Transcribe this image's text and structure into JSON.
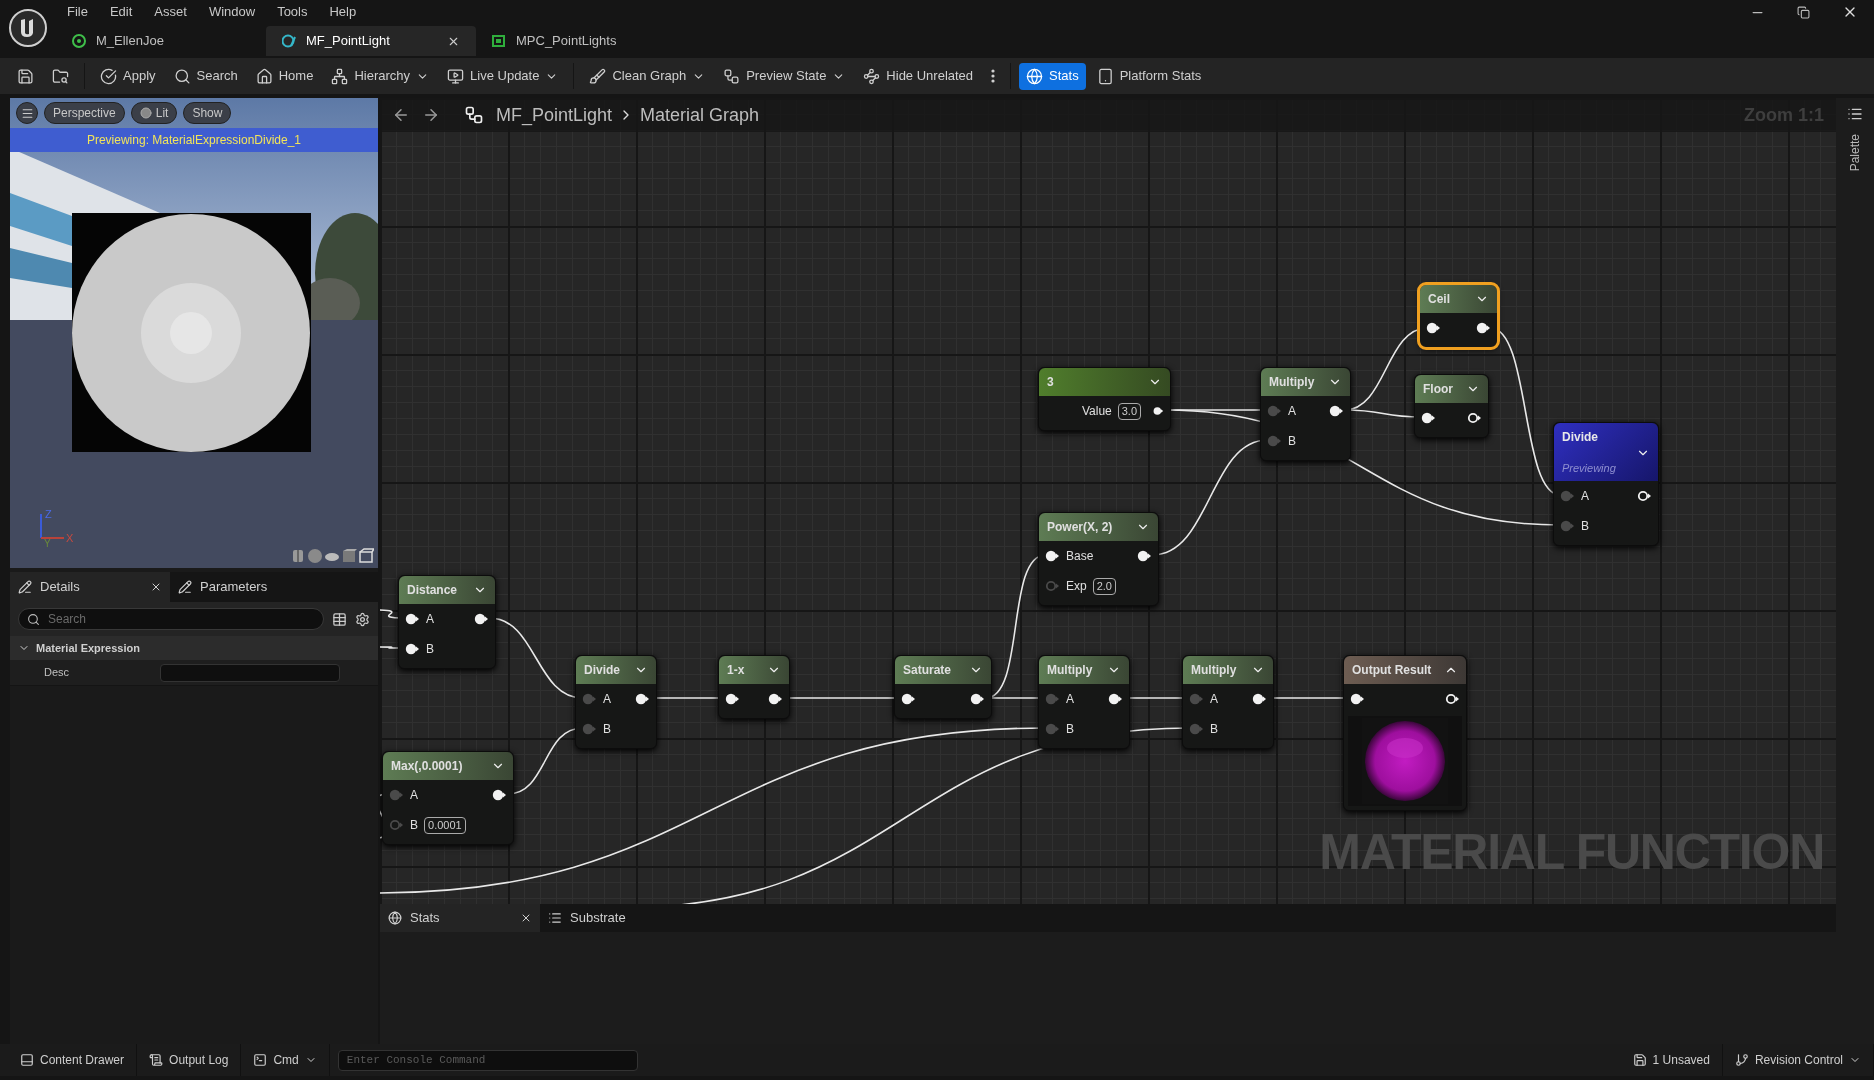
{
  "window": {
    "menu": [
      "File",
      "Edit",
      "Asset",
      "Window",
      "Tools",
      "Help"
    ]
  },
  "tabs": [
    {
      "kind": "material",
      "label": "M_EllenJoe",
      "selected": false
    },
    {
      "kind": "function",
      "label": "MF_PointLight",
      "selected": true
    },
    {
      "kind": "collection",
      "label": "MPC_PointLights",
      "selected": false
    }
  ],
  "toolbar": {
    "groups": [
      [
        {
          "kind": "save",
          "selected": false,
          "dropdown": false
        },
        {
          "kind": "browse",
          "selected": false,
          "dropdown": false
        }
      ],
      [
        {
          "kind": "apply",
          "label": "Apply",
          "selected": false,
          "dropdown": false
        },
        {
          "kind": "search",
          "label": "Search",
          "selected": false,
          "dropdown": false
        },
        {
          "kind": "home",
          "label": "Home",
          "selected": false,
          "dropdown": false
        },
        {
          "kind": "hierarchy",
          "label": "Hierarchy",
          "selected": false,
          "dropdown": true
        },
        {
          "kind": "live",
          "label": "Live Update",
          "selected": false,
          "dropdown": true
        }
      ],
      [
        {
          "kind": "clean",
          "label": "Clean Graph",
          "selected": false,
          "dropdown": true
        },
        {
          "kind": "preview",
          "label": "Preview State",
          "selected": false,
          "dropdown": true
        },
        {
          "kind": "hide",
          "label": "Hide Unrelated",
          "selected": false,
          "dropdown": false
        },
        {
          "kind": "more",
          "selected": false,
          "dropdown": false
        }
      ],
      [
        {
          "kind": "stats",
          "label": "Stats",
          "selected": true,
          "dropdown": false
        },
        {
          "kind": "platform",
          "label": "Platform Stats",
          "selected": false,
          "dropdown": false
        }
      ]
    ]
  },
  "viewport": {
    "toolbar": [
      {
        "kind": "menu"
      },
      {
        "kind": "view",
        "label": "Perspective"
      },
      {
        "kind": "lit",
        "label": "Lit"
      },
      {
        "kind": "view",
        "label": "Show"
      }
    ],
    "banner": "Previewing: MaterialExpressionDivide_1",
    "axes": [
      "Z",
      "Y",
      "X"
    ]
  },
  "details": {
    "tabs": [
      {
        "label": "Details",
        "selected": true
      },
      {
        "label": "Parameters",
        "selected": false
      }
    ],
    "search": {
      "placeholder": "Search"
    },
    "sections": [
      {
        "title": "Material Expression",
        "expanded": true,
        "rows": [
          {
            "label": "Desc"
          }
        ]
      }
    ]
  },
  "graph": {
    "breadcrumb": [
      "MF_PointLight",
      "Material Graph"
    ],
    "zoom": "Zoom 1:1",
    "watermark": "MATERIAL FUNCTION",
    "nodes": [
      {
        "kind": "function",
        "title": "Ceil",
        "selected": true,
        "rows": [
          {
            "in_pin": {
              "filled": true,
              "bright": true
            },
            "out_pin": {
              "filled": true,
              "bright": true
            }
          }
        ]
      },
      {
        "kind": "constant",
        "title": "3",
        "selected": false,
        "rows": [
          {
            "label": "Value",
            "field": "3.0",
            "out_pin": {
              "filled": true,
              "bright": true
            }
          }
        ]
      },
      {
        "kind": "function",
        "title": "Multiply",
        "selected": false,
        "rows": [
          {
            "in_pin": {
              "filled": true,
              "bright": false
            },
            "label": "A",
            "out_pin": {
              "filled": true,
              "bright": true
            }
          },
          {
            "in_pin": {
              "filled": true,
              "bright": false
            },
            "label": "B"
          }
        ]
      },
      {
        "kind": "function",
        "title": "Floor",
        "selected": false,
        "rows": [
          {
            "in_pin": {
              "filled": true,
              "bright": true
            },
            "out_pin": {
              "filled": false,
              "bright": true
            }
          }
        ]
      },
      {
        "kind": "previewing",
        "title": "Divide",
        "subtitle": "Previewing",
        "selected": false,
        "rows": [
          {
            "in_pin": {
              "filled": true,
              "bright": false
            },
            "label": "A",
            "out_pin": {
              "filled": false,
              "bright": true
            }
          },
          {
            "in_pin": {
              "filled": true,
              "bright": false
            },
            "label": "B"
          }
        ]
      },
      {
        "kind": "function",
        "title": "Power(X, 2)",
        "selected": false,
        "rows": [
          {
            "in_pin": {
              "filled": true,
              "bright": true
            },
            "label": "Base",
            "out_pin": {
              "filled": true,
              "bright": true
            }
          },
          {
            "in_pin": {
              "filled": false,
              "bright": false
            },
            "label": "Exp",
            "field": "2.0"
          }
        ]
      },
      {
        "kind": "function",
        "title": "Distance",
        "selected": false,
        "rows": [
          {
            "in_pin": {
              "filled": true,
              "bright": true
            },
            "label": "A",
            "out_pin": {
              "filled": true,
              "bright": true
            }
          },
          {
            "in_pin": {
              "filled": true,
              "bright": true
            },
            "label": "B"
          }
        ]
      },
      {
        "kind": "function",
        "title": "Divide",
        "selected": false,
        "rows": [
          {
            "in_pin": {
              "filled": true,
              "bright": false
            },
            "label": "A",
            "out_pin": {
              "filled": true,
              "bright": true
            }
          },
          {
            "in_pin": {
              "filled": true,
              "bright": false
            },
            "label": "B"
          }
        ]
      },
      {
        "kind": "function",
        "title": "1-x",
        "selected": false,
        "rows": [
          {
            "in_pin": {
              "filled": true,
              "bright": true
            },
            "out_pin": {
              "filled": true,
              "bright": true
            }
          }
        ]
      },
      {
        "kind": "function",
        "title": "Saturate",
        "selected": false,
        "rows": [
          {
            "in_pin": {
              "filled": true,
              "bright": true
            },
            "out_pin": {
              "filled": true,
              "bright": true
            }
          }
        ]
      },
      {
        "kind": "function",
        "title": "Multiply",
        "selected": false,
        "rows": [
          {
            "in_pin": {
              "filled": true,
              "bright": false
            },
            "label": "A",
            "out_pin": {
              "filled": true,
              "bright": true
            }
          },
          {
            "in_pin": {
              "filled": true,
              "bright": false
            },
            "label": "B"
          }
        ]
      },
      {
        "kind": "function",
        "title": "Multiply",
        "selected": false,
        "rows": [
          {
            "in_pin": {
              "filled": true,
              "bright": false
            },
            "label": "A",
            "out_pin": {
              "filled": true,
              "bright": true
            }
          },
          {
            "in_pin": {
              "filled": true,
              "bright": false
            },
            "label": "B"
          }
        ]
      },
      {
        "kind": "output",
        "title": "Output Result",
        "selected": false,
        "rows": [
          {
            "in_pin": {
              "filled": true,
              "bright": true
            },
            "out_pin": {
              "filled": false,
              "bright": true
            }
          }
        ]
      },
      {
        "kind": "function",
        "title": "Max(,0.0001)",
        "selected": false,
        "rows": [
          {
            "in_pin": {
              "filled": true,
              "bright": false
            },
            "label": "A",
            "out_pin": {
              "filled": true,
              "bright": true
            }
          },
          {
            "in_pin": {
              "filled": false,
              "bright": false
            },
            "label": "B",
            "field": "0.0001"
          }
        ]
      }
    ]
  },
  "palette": {
    "label": "Palette"
  },
  "bottom_panel": {
    "tabs": [
      {
        "label": "Stats",
        "selected": true
      },
      {
        "label": "Substrate",
        "selected": false
      }
    ]
  },
  "status_bar": {
    "left": [
      {
        "kind": "drawer",
        "label": "Content Drawer"
      },
      {
        "kind": "log",
        "label": "Output Log"
      },
      {
        "kind": "cmd",
        "label": "Cmd"
      }
    ],
    "console": {
      "placeholder": "Enter Console Command"
    },
    "right": [
      {
        "kind": "unsaved",
        "label": "1 Unsaved"
      },
      {
        "kind": "revision",
        "label": "Revision Control"
      }
    ]
  }
}
